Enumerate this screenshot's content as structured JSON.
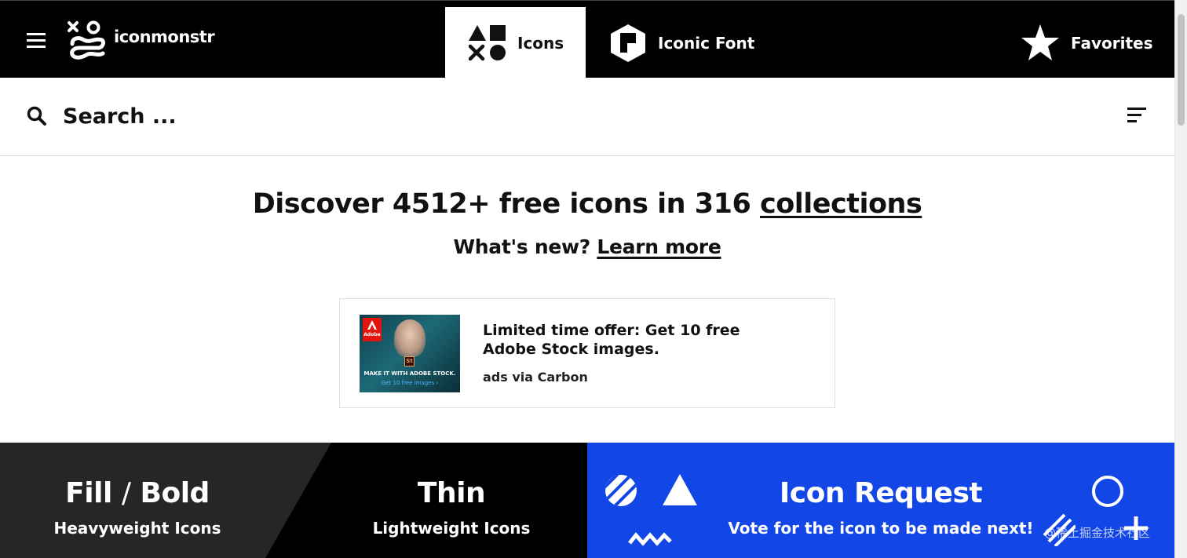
{
  "brand": {
    "name": "iconmonstr"
  },
  "nav": {
    "tabs": [
      {
        "label": "Icons",
        "icon": "shapes-icon",
        "active": true
      },
      {
        "label": "Iconic Font",
        "icon": "font-logo-icon",
        "active": false
      },
      {
        "label": "Favorites",
        "icon": "star-icon",
        "active": false
      }
    ]
  },
  "search": {
    "placeholder": "Search ...",
    "value": ""
  },
  "hero": {
    "title_prefix": "Discover 4512+ free icons in 316 ",
    "title_link": "collections",
    "subtitle_prefix": "What's new? ",
    "subtitle_link": "Learn more"
  },
  "ad": {
    "headline": "Limited time offer: Get 10 free Adobe Stock images.",
    "via": "ads via Carbon",
    "image": {
      "logo": "Adobe",
      "badge": "St",
      "line1": "MAKE IT WITH ADOBE STOCK.",
      "line2": "Get 10 free images ›"
    }
  },
  "panels": {
    "fill": {
      "title_a": "Fill",
      "separator": "/",
      "title_b": "Bold",
      "subtitle": "Heavyweight Icons"
    },
    "thin": {
      "title": "Thin",
      "subtitle": "Lightweight Icons"
    },
    "request": {
      "title": "Icon Request",
      "subtitle": "Vote for the icon to be made next!"
    }
  },
  "watermark": "@稀土掘金技术社区",
  "colors": {
    "topbar": "#000000",
    "fill_panel": "#262626",
    "thin_panel": "#000000",
    "request_panel": "#1346e6"
  }
}
